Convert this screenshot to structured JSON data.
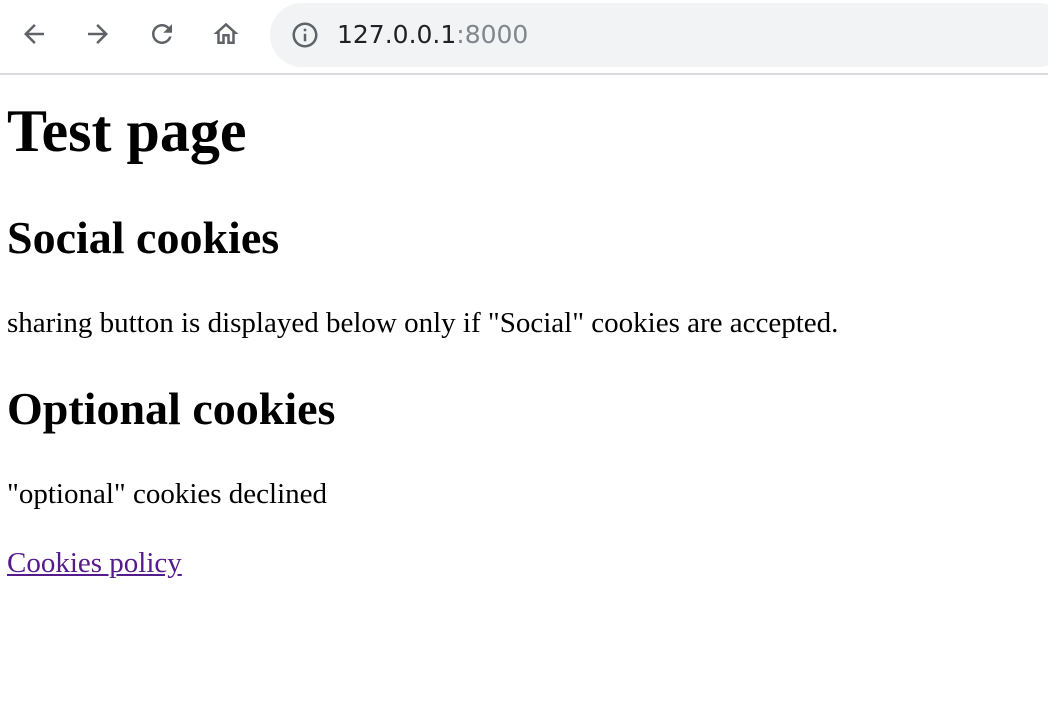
{
  "browser": {
    "url_host": "127.0.0.1",
    "url_port": ":8000",
    "icons": [
      "back-arrow-icon",
      "forward-arrow-icon",
      "reload-icon",
      "home-icon",
      "info-icon"
    ]
  },
  "page": {
    "title": "Test page",
    "sections": [
      {
        "heading": "Social cookies",
        "text": "sharing button is displayed below only if \"Social\" cookies are accepted."
      },
      {
        "heading": "Optional cookies",
        "text": "\"optional\" cookies declined"
      }
    ],
    "link_label": "Cookies policy"
  },
  "colors": {
    "link_visited": "#551a8b",
    "omnibox_bg": "#f1f3f4"
  }
}
